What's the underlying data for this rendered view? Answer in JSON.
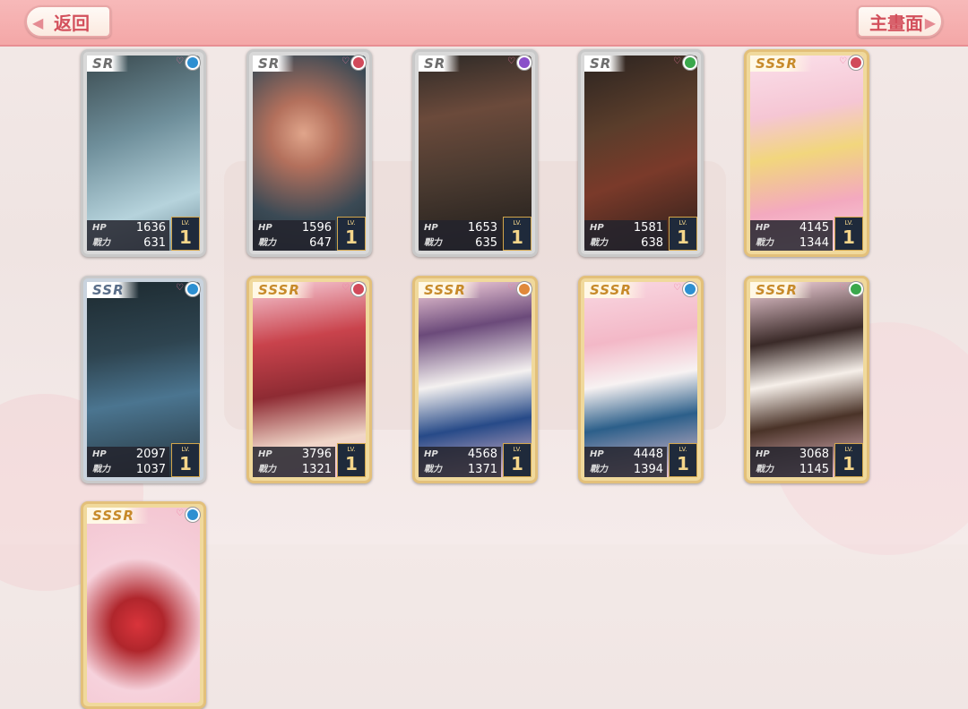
{
  "header": {
    "back_label": "返回",
    "main_label": "主畫面"
  },
  "cards": [
    {
      "rarity": "SR",
      "hp_label": "HP",
      "hp": "1636",
      "power_label": "戰力",
      "power": "631",
      "lv_label": "LV.",
      "level": "1",
      "element_color": "#2d8fd1"
    },
    {
      "rarity": "SR",
      "hp_label": "HP",
      "hp": "1596",
      "power_label": "戰力",
      "power": "647",
      "lv_label": "LV.",
      "level": "1",
      "element_color": "#d14a5a"
    },
    {
      "rarity": "SR",
      "hp_label": "HP",
      "hp": "1653",
      "power_label": "戰力",
      "power": "635",
      "lv_label": "LV.",
      "level": "1",
      "element_color": "#8a4fc9"
    },
    {
      "rarity": "SR",
      "hp_label": "HP",
      "hp": "1581",
      "power_label": "戰力",
      "power": "638",
      "lv_label": "LV.",
      "level": "1",
      "element_color": "#3aa84c"
    },
    {
      "rarity": "SSSR",
      "hp_label": "HP",
      "hp": "4145",
      "power_label": "戰力",
      "power": "1344",
      "lv_label": "LV.",
      "level": "1",
      "element_color": "#d14a5a"
    },
    {
      "rarity": "SSR",
      "hp_label": "HP",
      "hp": "2097",
      "power_label": "戰力",
      "power": "1037",
      "lv_label": "LV.",
      "level": "1",
      "element_color": "#2d8fd1"
    },
    {
      "rarity": "SSSR",
      "hp_label": "HP",
      "hp": "3796",
      "power_label": "戰力",
      "power": "1321",
      "lv_label": "LV.",
      "level": "1",
      "element_color": "#d14a5a"
    },
    {
      "rarity": "SSSR",
      "hp_label": "HP",
      "hp": "4568",
      "power_label": "戰力",
      "power": "1371",
      "lv_label": "LV.",
      "level": "1",
      "element_color": "#e0893a"
    },
    {
      "rarity": "SSSR",
      "hp_label": "HP",
      "hp": "4448",
      "power_label": "戰力",
      "power": "1394",
      "lv_label": "LV.",
      "level": "1",
      "element_color": "#2d8fd1"
    },
    {
      "rarity": "SSSR",
      "hp_label": "HP",
      "hp": "3068",
      "power_label": "戰力",
      "power": "1145",
      "lv_label": "LV.",
      "level": "1",
      "element_color": "#3aa84c"
    },
    {
      "rarity": "SSSR",
      "element_color": "#2d8fd1"
    }
  ],
  "colors": {
    "topbar": "#f4a7a7",
    "button_text": "#d3505c",
    "sssr_frame": "#e3c07a"
  }
}
